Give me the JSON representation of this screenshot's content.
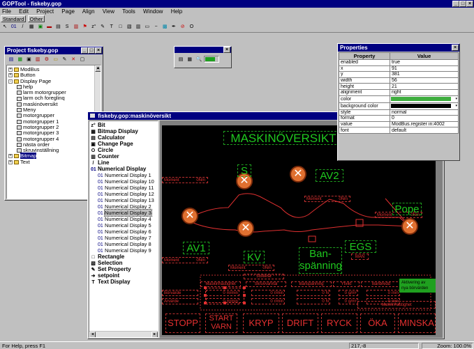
{
  "app": {
    "title": "GOPTool - fiskeby.gop",
    "window_controls": [
      "_",
      "□",
      "×"
    ]
  },
  "menu": [
    "File",
    "Edit",
    "Project",
    "Page",
    "Align",
    "View",
    "Tools",
    "Window",
    "Help"
  ],
  "toolbar_tabs": [
    "Standard",
    "Other"
  ],
  "floating_toolbar": {
    "color": "#1fa01f"
  },
  "project_window": {
    "title": "Project fiskeby.gop",
    "tree": [
      {
        "label": "ModBus",
        "level": 0,
        "type": "folder",
        "expander": "+"
      },
      {
        "label": "Button",
        "level": 0,
        "type": "folder",
        "expander": "+"
      },
      {
        "label": "Display Page",
        "level": 0,
        "type": "folder",
        "expander": "-"
      },
      {
        "label": "help",
        "level": 1,
        "type": "page"
      },
      {
        "label": "larm motorgrupper",
        "level": 1,
        "type": "page"
      },
      {
        "label": "larm och foreglinq",
        "level": 1,
        "type": "page"
      },
      {
        "label": "maskinöversikt",
        "level": 1,
        "type": "page"
      },
      {
        "label": "Meny",
        "level": 1,
        "type": "page"
      },
      {
        "label": "motorgrupper",
        "level": 1,
        "type": "page"
      },
      {
        "label": "motorgrupper 1",
        "level": 1,
        "type": "page"
      },
      {
        "label": "motorgrupper 2",
        "level": 1,
        "type": "page"
      },
      {
        "label": "motorgrupper 3",
        "level": 1,
        "type": "page"
      },
      {
        "label": "motorgrupper 4",
        "level": 1,
        "type": "page"
      },
      {
        "label": "nästa order",
        "level": 1,
        "type": "page"
      },
      {
        "label": "skruvinställning",
        "level": 1,
        "type": "page"
      },
      {
        "label": "Bitmap",
        "level": 0,
        "type": "folder",
        "expander": "+",
        "selected": true
      },
      {
        "label": "Text",
        "level": 0,
        "type": "folder",
        "expander": "+"
      }
    ]
  },
  "page_window": {
    "title": "fiskeby.gop:maskinöversikt",
    "palette": [
      {
        "icon": "z°",
        "label": "Bit",
        "bold": true
      },
      {
        "icon": "▦",
        "label": "Bitmap Display",
        "bold": true
      },
      {
        "icon": "▤",
        "label": "Calculator",
        "bold": true
      },
      {
        "icon": "▣",
        "label": "Change Page",
        "bold": true
      },
      {
        "icon": "O",
        "label": "Circle",
        "bold": true
      },
      {
        "icon": "▥",
        "label": "Counter",
        "bold": true
      },
      {
        "icon": "/",
        "label": "Line",
        "bold": true
      },
      {
        "icon": "01",
        "label": "Numerical Display",
        "bold": true
      },
      {
        "icon": "01",
        "label": "Numerical Display 1",
        "sub": true
      },
      {
        "icon": "01",
        "label": "Numerical Display 10",
        "sub": true
      },
      {
        "icon": "01",
        "label": "Numerical Display 11",
        "sub": true
      },
      {
        "icon": "01",
        "label": "Numerical Display 12",
        "sub": true
      },
      {
        "icon": "01",
        "label": "Numerical Display 13",
        "sub": true
      },
      {
        "icon": "01",
        "label": "Numerical Display 2",
        "sub": true
      },
      {
        "icon": "01",
        "label": "Numerical Display 3",
        "sub": true,
        "selected": true
      },
      {
        "icon": "01",
        "label": "Numerical Display 4",
        "sub": true
      },
      {
        "icon": "01",
        "label": "Numerical Display 5",
        "sub": true
      },
      {
        "icon": "01",
        "label": "Numerical Display 6",
        "sub": true
      },
      {
        "icon": "01",
        "label": "Numerical Display 7",
        "sub": true
      },
      {
        "icon": "01",
        "label": "Numerical Display 8",
        "sub": true
      },
      {
        "icon": "01",
        "label": "Numerical Display 9",
        "sub": true
      },
      {
        "icon": "□",
        "label": "Rectangle",
        "bold": true
      },
      {
        "icon": "▧",
        "label": "Selection",
        "bold": true
      },
      {
        "icon": "✎",
        "label": "Set Property",
        "bold": true
      },
      {
        "icon": "➔",
        "label": "setpoint",
        "bold": true
      },
      {
        "icon": "T",
        "label": "Text Display",
        "bold": true
      }
    ]
  },
  "hmi": {
    "title": "MASKINÖVERSIKT",
    "moment_label": "Moment",
    "nm_label": "0Nm",
    "labels": {
      "s": "S",
      "av2": "AV2",
      "pope": "Pope",
      "av1": "AV1",
      "kv": "KV",
      "egs": "EGS",
      "man": "MAN",
      "ban": "Ban-",
      "spanning": "spänning"
    },
    "table_headers": [
      "Maskinhastighet",
      "Skruvvarvtal",
      "Banspänning",
      "Ytvikt",
      "Banbredd"
    ],
    "justerat": "Justerat",
    "row_labels": [
      "Börvärde",
      "Ärvärde"
    ],
    "units": {
      "mmin": "m/min",
      "rmin": "r/min",
      "n": "N",
      "gm2": "g/m²",
      "mm": "mm"
    },
    "zero": "0",
    "aktivering": [
      "Aktivering av",
      "nya börvärden"
    ],
    "maskinhastighet_box": "Maskinhastighet",
    "buttons": [
      "STOPP",
      "START VARN",
      "KRYP",
      "DRIFT",
      "RYCK",
      "ÖKA",
      "MINSKA"
    ]
  },
  "properties": {
    "title": "Properties",
    "headers": [
      "Property",
      "Value"
    ],
    "rows": [
      {
        "p": "enabled",
        "v": "true"
      },
      {
        "p": "x",
        "v": "91"
      },
      {
        "p": "y",
        "v": "381"
      },
      {
        "p": "width",
        "v": "56"
      },
      {
        "p": "height",
        "v": "21"
      },
      {
        "p": "alignment",
        "v": "right"
      },
      {
        "p": "color",
        "v": "",
        "swatch": "#3fae3f"
      },
      {
        "p": "background color",
        "v": "",
        "swatch": "#000000"
      },
      {
        "p": "style",
        "v": "normal"
      },
      {
        "p": "format",
        "v": "0"
      },
      {
        "p": "value",
        "v": "ModBus.register in:4002"
      },
      {
        "p": "font",
        "v": "default"
      }
    ]
  },
  "status_bar": {
    "help": "For Help, press F1",
    "coords": "217,-8",
    "zoom": "Zoom: 100.0%"
  }
}
